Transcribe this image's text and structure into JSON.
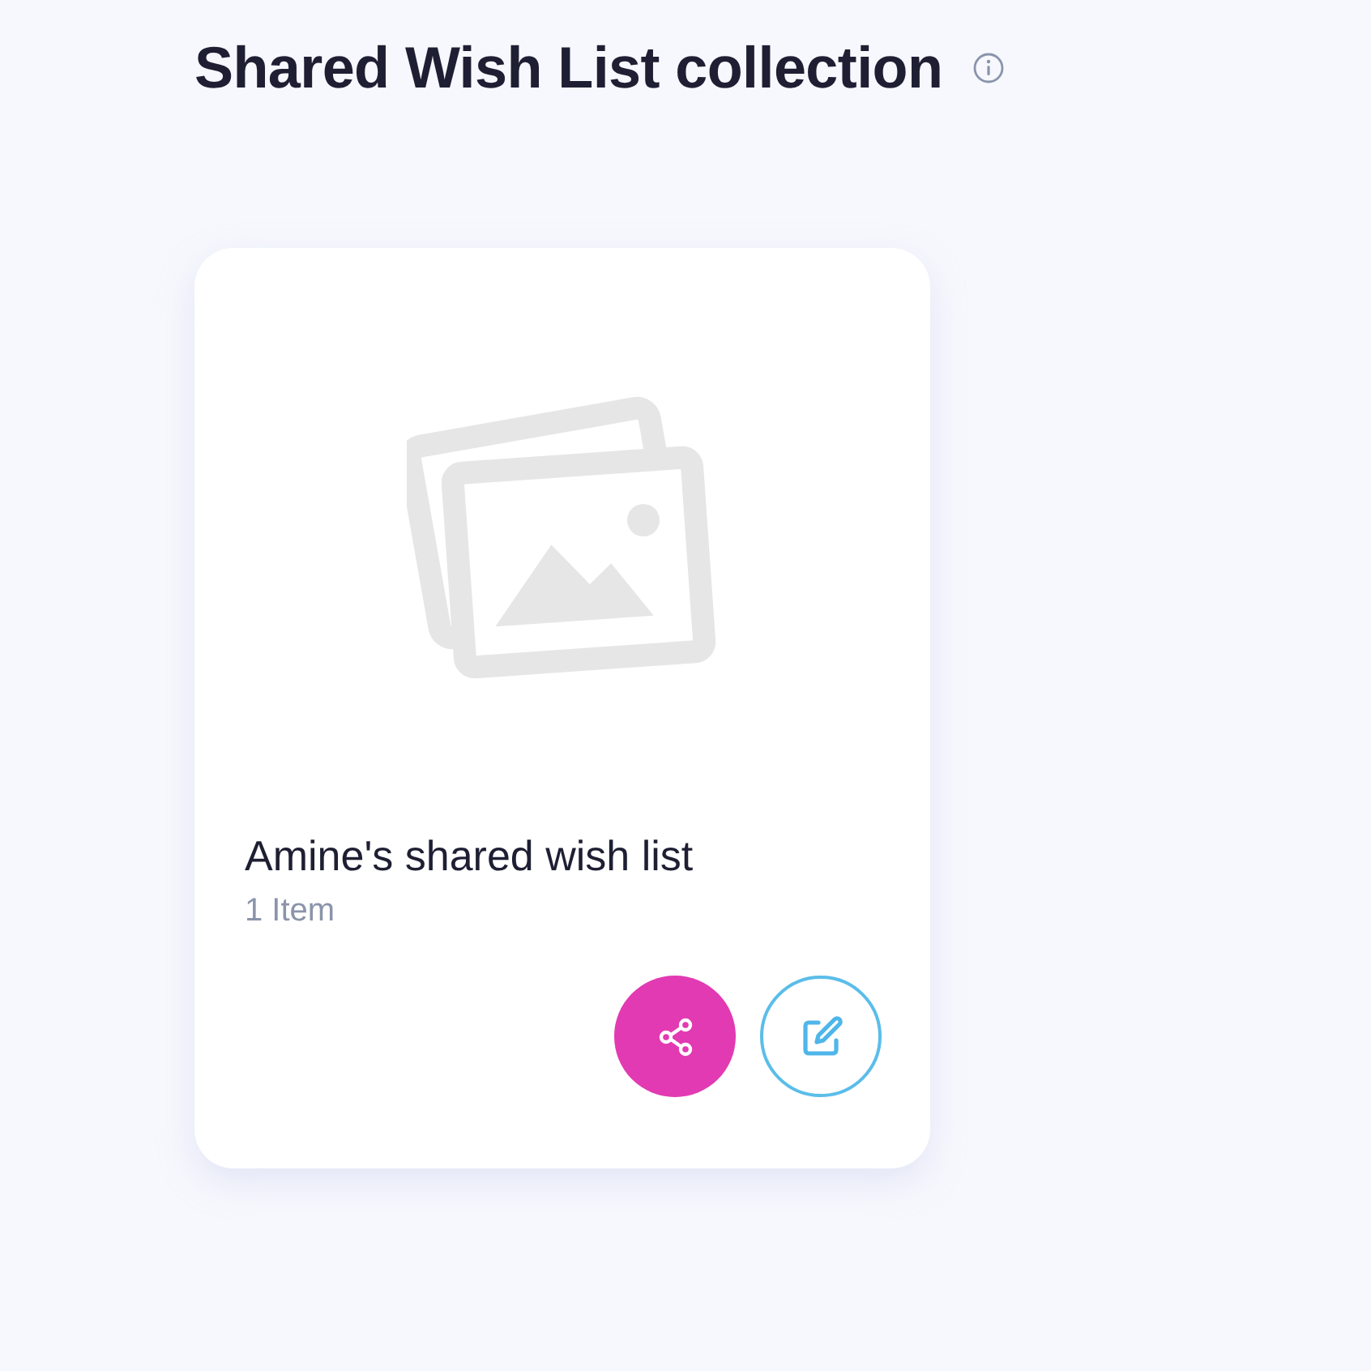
{
  "page": {
    "title": "Shared Wish List collection"
  },
  "wishlists": [
    {
      "name": "Amine's shared wish list",
      "count": "1 Item",
      "image": {
        "kind": "placeholder"
      }
    }
  ]
}
